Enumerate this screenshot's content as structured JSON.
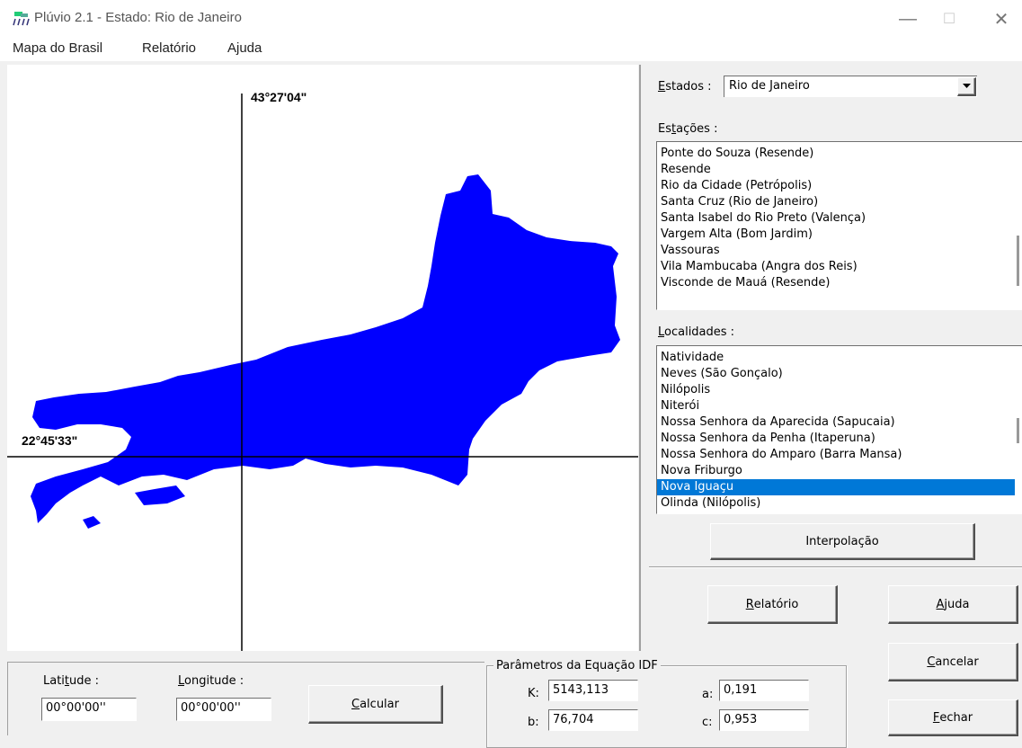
{
  "window": {
    "title": "Plúvio 2.1 - Estado: Rio de Janeiro",
    "minimize_glyph": "—",
    "maximize_glyph": "☐",
    "close_glyph": "✕"
  },
  "menu": {
    "items": [
      "Mapa do Brasil",
      "Relatório",
      "Ajuda"
    ]
  },
  "map": {
    "longitude_label": "43°27'04\"",
    "latitude_label": "22°45'33\"",
    "fill_color": "#0000ff"
  },
  "estados": {
    "label_underlined": "E",
    "label_rest": "stados :",
    "selected": "Rio de Janeiro"
  },
  "estacoes": {
    "label_pre": "Es",
    "label_underlined": "t",
    "label_post": "ações :",
    "items": [
      "Ponte do Souza (Resende)",
      "Resende",
      "Rio da Cidade (Petrópolis)",
      "Santa Cruz (Rio de Janeiro)",
      "Santa Isabel do Rio Preto (Valença)",
      "Vargem Alta (Bom Jardim)",
      "Vassouras",
      "Vila Mambucaba (Angra dos Reis)",
      "Visconde de Mauá (Resende)"
    ]
  },
  "localidades": {
    "label_underlined": "L",
    "label_rest": "ocalidades :",
    "items": [
      "Natividade",
      "Neves (São Gonçalo)",
      "Nilópolis",
      "Niterói",
      "Nossa Senhora da Aparecida (Sapucaia)",
      "Nossa Senhora da Penha (Itaperuna)",
      "Nossa Senhora do Amparo (Barra Mansa)",
      "Nova Friburgo",
      "Nova Iguaçu",
      "Olinda (Nilópolis)"
    ],
    "selected": "Nova Iguaçu"
  },
  "buttons": {
    "interpolacao": "Interpolação",
    "relatorio_u": "R",
    "relatorio_rest": "elatório",
    "ajuda_u": "A",
    "ajuda_rest": "juda",
    "cancelar_u": "C",
    "cancelar_rest": "ancelar",
    "fechar_u": "F",
    "fechar_rest": "echar",
    "calcular_u": "C",
    "calcular_rest": "alcular"
  },
  "coords": {
    "latitude_label_pre": "Lati",
    "latitude_label_u": "t",
    "latitude_label_post": "ude :",
    "latitude_value": "00°00'00''",
    "longitude_label_u": "L",
    "longitude_label_rest": "ongitude :",
    "longitude_value": "00°00'00''"
  },
  "idf": {
    "group_label": "Parâmetros da Equação IDF",
    "K_label": "K:",
    "K_value": "5143,113",
    "b_label": "b:",
    "b_value": "76,704",
    "a_label": "a:",
    "a_value": "0,191",
    "c_label": "c:",
    "c_value": "0,953"
  }
}
